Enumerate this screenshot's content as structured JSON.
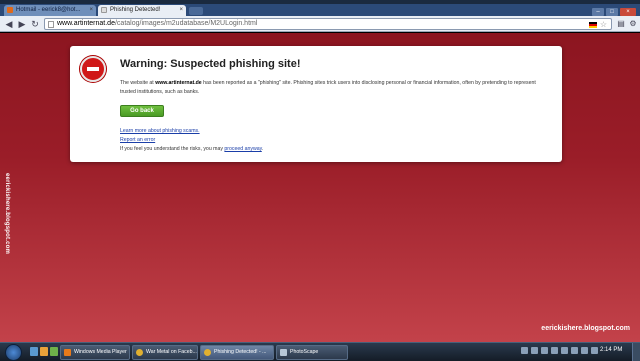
{
  "browser": {
    "tabs": [
      {
        "label": "Hotmail - eerick8@hot...",
        "active": false
      },
      {
        "label": "Phishing Detected!",
        "active": true
      }
    ],
    "url": {
      "domain": "www.artinternat.de",
      "path": "/catalog/images/m2udatabase/M2ULogin.html"
    }
  },
  "warning": {
    "title": "Warning: Suspected phishing site!",
    "desc_prefix": "The website at ",
    "desc_site": "www.artinternat.de",
    "desc_rest": " has been reported as a \"phishing\" site. Phishing sites trick users into disclosing personal or financial information, often by pretending to represent trusted institutions, such as banks.",
    "go_back_label": "Go back",
    "learn_more": "Learn more about phishing scams.",
    "report_error": "Report an error",
    "proceed_prefix": "If you feel you understand the risks, you may ",
    "proceed_link": "proceed anyway",
    "proceed_suffix": "."
  },
  "overlay": {
    "side_text": "eerickishere.blogspot.com",
    "watermark": "eerickishere.blogspot.com"
  },
  "taskbar": {
    "tasks": [
      {
        "label": "Windows Media Player"
      },
      {
        "label": "War Metal on Faceb..."
      },
      {
        "label": "Phishing Detected! - ..."
      },
      {
        "label": "PhotoScape"
      }
    ],
    "clock": "2:14 PM"
  },
  "colors": {
    "page_bg": "#9a1d28",
    "stop": "#d01818",
    "go_back": "#4a9b25",
    "link": "#1a3ea8"
  }
}
